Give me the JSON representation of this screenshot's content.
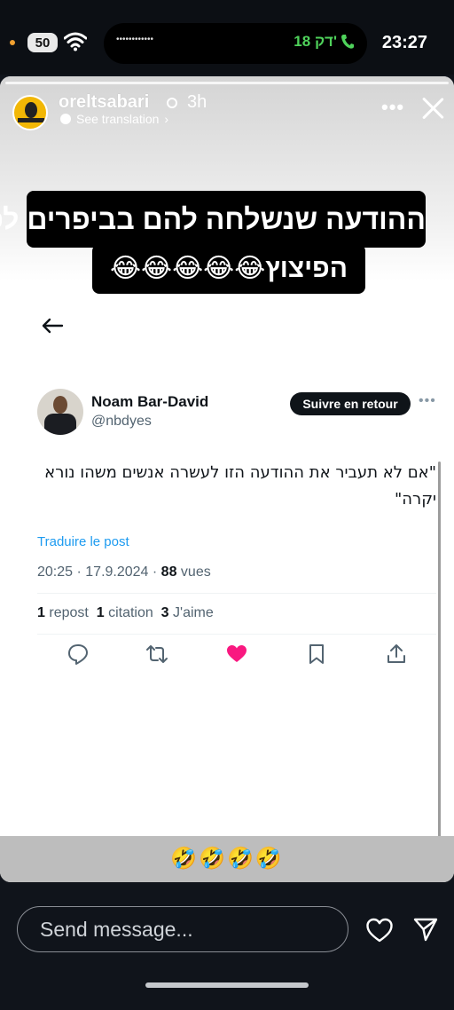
{
  "status_bar": {
    "battery": "50",
    "call_duration": "18 דק'",
    "time": "23:27",
    "island_dots": "••••••••••••"
  },
  "story": {
    "username": "oreltsabari",
    "time_ago": "3h",
    "see_translation": "See translation",
    "more": "•••",
    "caption_line1": "ההודעה שנשלחה להם בביפרים לפני",
    "caption_line2": "הפיצוץ😂😂😂😂😂",
    "emoji_reaction": "🤣🤣🤣🤣",
    "tweet": {
      "author_name": "Noam Bar-David",
      "author_handle": "@nbdyes",
      "follow_label": "Suivre en retour",
      "more": "•••",
      "text": "\"אם לא תעביר את ההודעה הזו לעשרה אנשים משהו נורא יקרה\"",
      "translate_label": "Traduire le post",
      "time": "20:25",
      "date": "17.9.2024",
      "views_count": "88",
      "views_label": "vues",
      "reposts_count": "1",
      "reposts_label": "repost",
      "quotes_count": "1",
      "quotes_label": "citation",
      "likes_count": "3",
      "likes_label": "J'aime",
      "like_color": "#f91880"
    }
  },
  "reply_bar": {
    "placeholder": "Send message..."
  }
}
